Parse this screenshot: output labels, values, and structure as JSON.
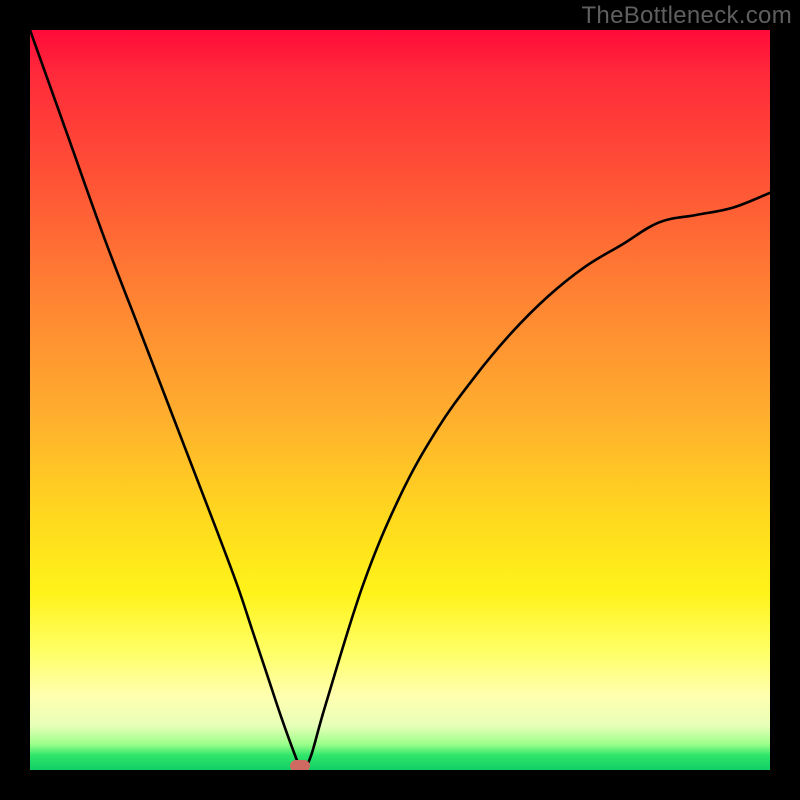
{
  "watermark": "TheBottleneck.com",
  "chart_data": {
    "type": "line",
    "title": "",
    "xlabel": "",
    "ylabel": "",
    "xlim": [
      0,
      100
    ],
    "ylim": [
      0,
      100
    ],
    "grid": false,
    "legend": false,
    "series": [
      {
        "name": "curve",
        "x": [
          0,
          5,
          10,
          15,
          20,
          25,
          28,
          30,
          32,
          34,
          36,
          36.5,
          37,
          38,
          40,
          45,
          50,
          55,
          60,
          65,
          70,
          75,
          80,
          85,
          90,
          95,
          100
        ],
        "values": [
          100,
          86,
          72,
          59,
          46,
          33,
          25,
          19,
          13,
          7,
          1.5,
          0.5,
          0.3,
          2,
          9,
          25,
          37,
          46,
          53,
          59,
          64,
          68,
          71,
          74,
          75,
          76,
          78
        ]
      }
    ],
    "marker": {
      "x": 36.5,
      "y": 0.5
    },
    "background_gradient": {
      "top": "#ff0a3a",
      "mid": "#ffd91e",
      "bottom": "#10cf66"
    }
  }
}
